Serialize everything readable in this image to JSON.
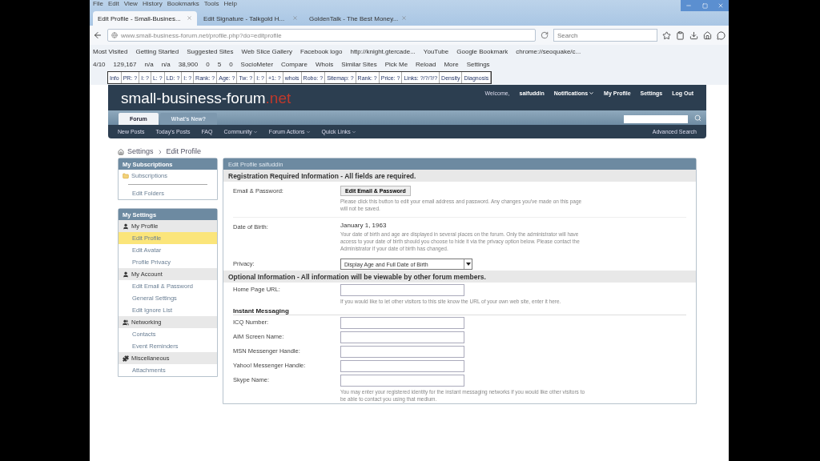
{
  "browser": {
    "menu": [
      "File",
      "Edit",
      "View",
      "History",
      "Bookmarks",
      "Tools",
      "Help"
    ],
    "tabs": [
      {
        "label": "Edit Profile - Small-Busines...",
        "selected": true
      },
      {
        "label": "Edit Signature - Talkgold H...",
        "selected": false
      },
      {
        "label": "GoldenTalk - The Best Money...",
        "selected": false
      }
    ],
    "url": "www.small-business-forum.net/profile.php?do=editprofile",
    "search": {
      "placeholder": "Search"
    },
    "bookmarks": [
      "Most Visited",
      "Getting Started",
      "Suggested Sites",
      "Web Slice Gallery",
      "Facebook logo",
      "http://knight.gtercade...",
      "YouTube",
      "Google Bookmark",
      "chrome://seoquake/c..."
    ],
    "seo_bar": [
      "4/10",
      "129,167",
      "n/a",
      "n/a",
      "38,900",
      "0",
      "5",
      "0",
      "SocioMeter",
      "Compare",
      "Whois",
      "Similar Sites",
      "Pick Me",
      "Reload",
      "More",
      "Settings"
    ],
    "seo_toolbar": [
      "Info",
      "PR: ?",
      "I: ?",
      "L: ?",
      "LD: ?",
      "I: ?",
      "Rank: ?",
      "Age: ?",
      "Tw: ?",
      "I: ?",
      "+1: ?",
      "whois",
      "Robo: ?",
      "Sitemap: ?",
      "Rank: ?",
      "Price: ?",
      "Links: ?/?/?/?",
      "Density",
      "Diagnosis"
    ]
  },
  "forum": {
    "logo": "small-business-forum",
    "logo_suffix": ".net",
    "welcome": "Welcome,",
    "user": "saifuddin",
    "user_links": [
      {
        "label": "Notifications",
        "dropdown": true
      },
      {
        "label": "My Profile",
        "dropdown": false
      },
      {
        "label": "Settings",
        "dropdown": false
      },
      {
        "label": "Log Out",
        "dropdown": false
      }
    ],
    "tabs": [
      {
        "label": "Forum",
        "selected": true
      },
      {
        "label": "What's New?",
        "selected": false
      }
    ],
    "subnav": [
      {
        "label": "New Posts",
        "dropdown": false
      },
      {
        "label": "Today's Posts",
        "dropdown": false
      },
      {
        "label": "FAQ",
        "dropdown": false
      },
      {
        "label": "Community",
        "dropdown": true
      },
      {
        "label": "Forum Actions",
        "dropdown": true
      },
      {
        "label": "Quick Links",
        "dropdown": true
      }
    ],
    "advanced_search": "Advanced Search"
  },
  "breadcrumb": [
    "Settings",
    "Edit Profile"
  ],
  "sidebar": [
    {
      "title": "My Subscriptions",
      "items": [
        {
          "kind": "folder",
          "label": "Subscriptions",
          "selected": false
        },
        {
          "kind": "divider"
        },
        {
          "kind": "link",
          "label": "Edit Folders",
          "selected": false
        }
      ]
    },
    {
      "title": "My Settings",
      "items": [
        {
          "kind": "group",
          "label": "My Profile",
          "children": [
            {
              "label": "Edit Profile",
              "selected": true
            },
            {
              "label": "Edit Avatar",
              "selected": false
            },
            {
              "label": "Profile Privacy",
              "selected": false
            }
          ]
        },
        {
          "kind": "group",
          "label": "My Account",
          "children": [
            {
              "label": "Edit Email & Password",
              "selected": false
            },
            {
              "label": "General Settings",
              "selected": false
            },
            {
              "label": "Edit Ignore List",
              "selected": false
            }
          ]
        },
        {
          "kind": "group",
          "label": "Networking",
          "children": [
            {
              "label": "Contacts",
              "selected": false
            },
            {
              "label": "Event Reminders",
              "selected": false
            }
          ]
        },
        {
          "kind": "group",
          "label": "Miscellaneous",
          "children": [
            {
              "label": "Attachments",
              "selected": false
            }
          ]
        }
      ]
    }
  ],
  "form": {
    "title": "Edit Profile saifuddin",
    "sections": [
      {
        "title": "Registration Required Information - All fields are required.",
        "rows": [
          {
            "kind": "button",
            "label": "Email & Password:",
            "button": "Edit Email & Password",
            "hint": "Please click this button to edit your email address and password. Any changes you've made on this page will not be saved."
          },
          {
            "kind": "value",
            "label": "Date of Birth:",
            "value": "January 1, 1963",
            "hint": "Your date of birth and age are displayed in several places on the forum. Only the administrator will have access to your date of birth should you choose to hide it via the privacy option below. Please contact the Administrator if your date of birth has changed."
          },
          {
            "kind": "select",
            "label": "Privacy:",
            "value": "Display Age and Full Date of Birth"
          }
        ]
      },
      {
        "title": "Optional Information - All information will be viewable by other forum members.",
        "rows": [
          {
            "kind": "input",
            "label": "Home Page URL:",
            "hint": "If you would like to let other visitors to this site know the URL of your own web site, enter it here."
          },
          {
            "kind": "subheading",
            "label": "Instant Messaging"
          },
          {
            "kind": "input",
            "label": "ICQ Number:"
          },
          {
            "kind": "input",
            "label": "AIM Screen Name:"
          },
          {
            "kind": "input",
            "label": "MSN Messenger Handle:"
          },
          {
            "kind": "input",
            "label": "Yahoo! Messenger Handle:"
          },
          {
            "kind": "input",
            "label": "Skype Name:",
            "hint": "You may enter your registered identity for the instant messaging networks if you would like other visitors to be able to contact you using that medium."
          }
        ]
      }
    ]
  }
}
